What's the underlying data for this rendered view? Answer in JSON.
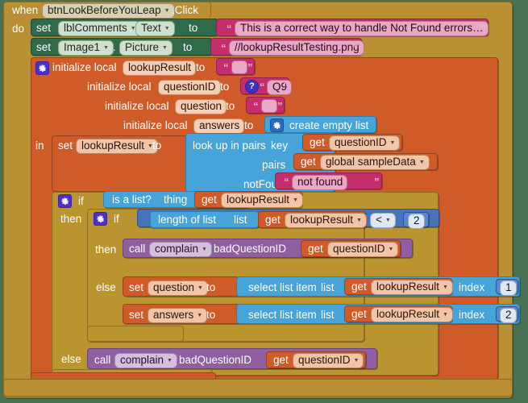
{
  "workspace": {
    "background_color": "#4a7151"
  },
  "palette": {
    "event": "#b99033",
    "control": "#b9942f",
    "component_set": "#2f6b4a",
    "variables": "#cf5b29",
    "text": "#c52e6c",
    "lists": "#47a4d8",
    "math": "#4573bd",
    "procedures": "#8f5fa2"
  },
  "event_block": {
    "when_label": "when",
    "component": "btnLookBeforeYouLeap",
    "event": ".Click",
    "do_label": "do"
  },
  "set_text_row": {
    "set_label": "set",
    "component": "lblComments",
    "dot": ".",
    "property": "Text",
    "to_label": "to",
    "value": "This is a correct way to handle Not Found errors…"
  },
  "set_picture_row": {
    "set_label": "set",
    "component": "Image1",
    "dot": ".",
    "property": "Picture",
    "to_label": "to",
    "value": "//lookupResultTesting.png"
  },
  "locals": {
    "init_label": "initialize local",
    "to_label": "to",
    "in_label": "in",
    "items": [
      {
        "name": "lookupResult",
        "value_kind": "empty-text",
        "value": ""
      },
      {
        "name": "questionID",
        "value_kind": "text-badge",
        "value": "Q9"
      },
      {
        "name": "question",
        "value_kind": "empty-text",
        "value": ""
      },
      {
        "name": "answers",
        "value_kind": "create-empty-list",
        "value": "create empty list"
      }
    ]
  },
  "lookup_row": {
    "set_label": "set",
    "variable": "lookupResult",
    "to_label": "to",
    "block_label": "look up in pairs",
    "key_label": "key",
    "key_value_get": "get",
    "key_value": "questionID",
    "pairs_label": "pairs",
    "pairs_value_get": "get",
    "pairs_value": "global sampleData",
    "notfound_label": "notFound",
    "notfound_value": "not found"
  },
  "outer_if": {
    "if_label": "if",
    "then_label": "then",
    "else_label": "else",
    "condition": {
      "block_label": "is a list?",
      "socket_label": "thing",
      "get_label": "get",
      "variable": "lookupResult"
    }
  },
  "inner_if": {
    "if_label": "if",
    "then_label": "then",
    "else_label": "else",
    "condition": {
      "block_label": "length of list",
      "socket_label": "list",
      "get_label": "get",
      "variable": "lookupResult",
      "operator": "<",
      "operand": "2"
    }
  },
  "complain_then": {
    "call_label": "call",
    "procedure": "complain",
    "arg_label": "badQuestionID",
    "get_label": "get",
    "arg_value": "questionID"
  },
  "complain_else": {
    "call_label": "call",
    "procedure": "complain",
    "arg_label": "badQuestionID",
    "get_label": "get",
    "arg_value": "questionID"
  },
  "set_question_row": {
    "set_label": "set",
    "variable": "question",
    "to_label": "to",
    "block_label": "select list item",
    "list_label": "list",
    "get_label": "get",
    "list_value": "lookupResult",
    "index_label": "index",
    "index_value": "1"
  },
  "set_answers_row": {
    "set_label": "set",
    "variable": "answers",
    "to_label": "to",
    "block_label": "select list item",
    "list_label": "list",
    "get_label": "get",
    "list_value": "lookupResult",
    "index_label": "index",
    "index_value": "2"
  }
}
